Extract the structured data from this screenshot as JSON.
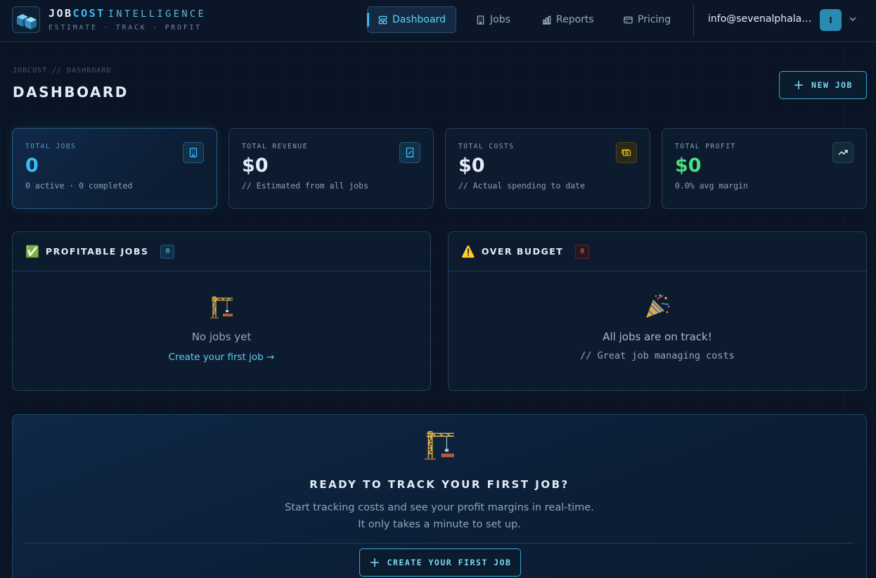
{
  "header": {
    "brand_word1": "JOB",
    "brand_word2": "COST",
    "brand_word3": "INTELLIGENCE",
    "tagline": "ESTIMATE · TRACK · PROFIT",
    "nav": [
      {
        "label": "Dashboard",
        "icon": "layout-icon",
        "active": true
      },
      {
        "label": "Jobs",
        "icon": "building-icon",
        "active": false
      },
      {
        "label": "Reports",
        "icon": "bar-chart-icon",
        "active": false
      },
      {
        "label": "Pricing",
        "icon": "credit-card-icon",
        "active": false
      }
    ],
    "user_email": "info@sevenalphalabs.com",
    "avatar_initial": "I"
  },
  "page": {
    "breadcrumb": "JOBCOST // DASHBOARD",
    "title": "DASHBOARD",
    "new_job_label": "NEW JOB"
  },
  "stats": [
    {
      "label": "TOTAL JOBS",
      "value": "0",
      "sub": "0 active · 0 completed",
      "icon": "building-icon",
      "color": "#38bdf8"
    },
    {
      "label": "TOTAL REVENUE",
      "value": "$0",
      "sub": "// Estimated from all jobs",
      "icon": "receipt-icon",
      "color": "#38bdf8"
    },
    {
      "label": "TOTAL COSTS",
      "value": "$0",
      "sub": "// Actual spending to date",
      "icon": "money-icon",
      "color": "#eab308"
    },
    {
      "label": "TOTAL PROFIT",
      "value": "$0",
      "sub": "0.0% avg margin",
      "icon": "trending-up-icon",
      "color": "#4ade80"
    }
  ],
  "panels": {
    "profitable": {
      "emoji": "✅",
      "title": "PROFITABLE JOBS",
      "count": "0",
      "empty_icon": "crane-icon",
      "empty_title": "No jobs yet",
      "empty_link": "Create your first job →"
    },
    "over_budget": {
      "emoji": "⚠️",
      "title": "OVER BUDGET",
      "count": "0",
      "empty_icon": "party-popper-icon",
      "empty_title": "All jobs are on track!",
      "empty_sub": "// Great job managing costs"
    }
  },
  "cta": {
    "icon": "crane-icon",
    "title": "READY TO TRACK YOUR FIRST JOB?",
    "text_line1": "Start tracking costs and see your profit margins in real-time.",
    "text_line2": "It only takes a minute to set up.",
    "button_label": "CREATE YOUR FIRST JOB"
  }
}
